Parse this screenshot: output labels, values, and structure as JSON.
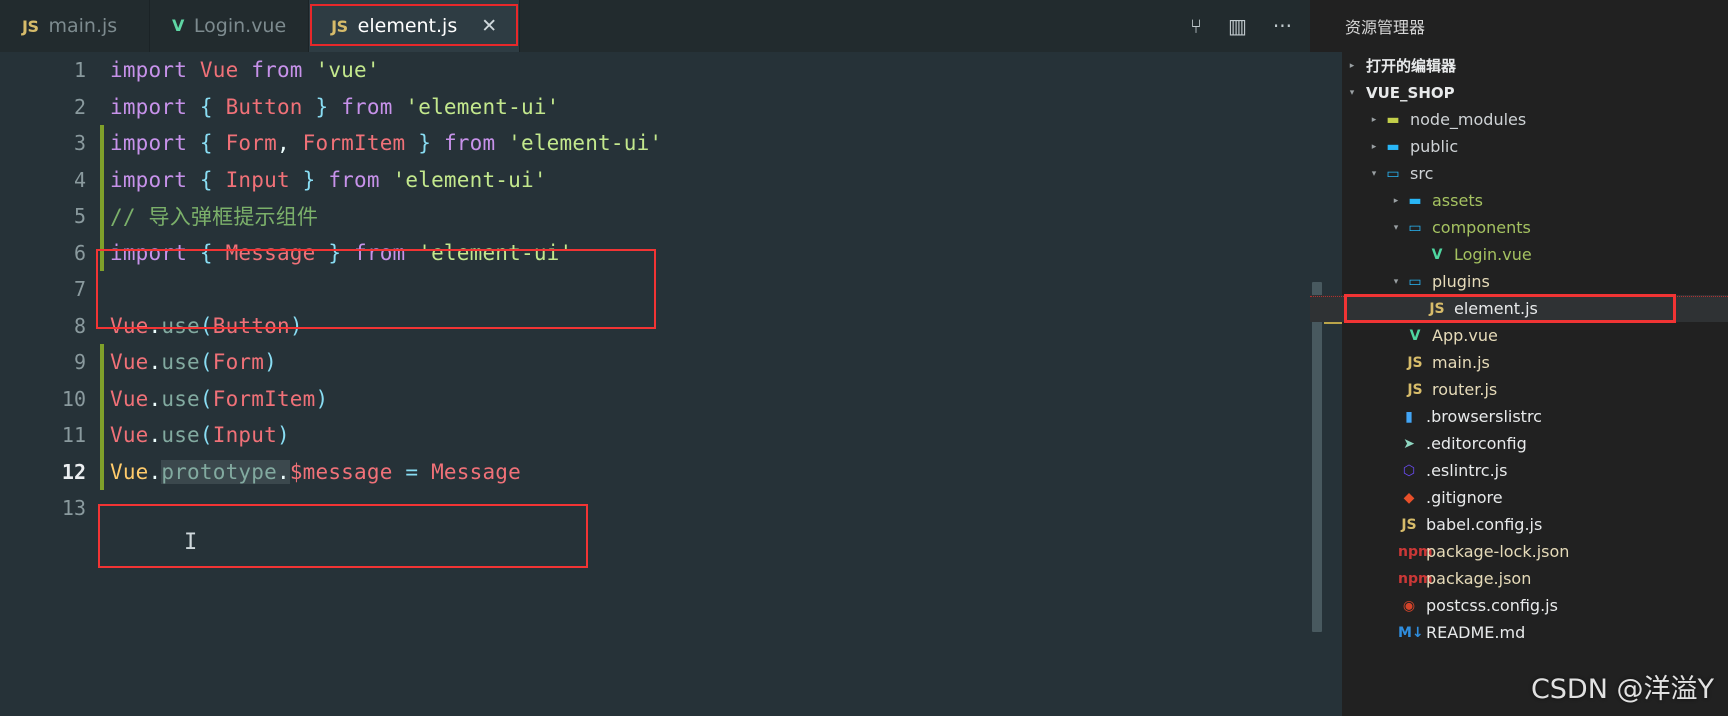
{
  "window": {
    "explorer_title": "资源管理器",
    "watermark": "CSDN @洋溢Y"
  },
  "tabbar": {
    "tabs": [
      {
        "label": "main.js",
        "icon": "js-file-icon",
        "active": false,
        "highlighted": false,
        "closable": false
      },
      {
        "label": "Login.vue",
        "icon": "vue-file-icon",
        "active": false,
        "highlighted": false,
        "closable": false
      },
      {
        "label": "element.js",
        "icon": "js-file-icon",
        "active": true,
        "highlighted": true,
        "closable": true
      }
    ],
    "close_glyph": "✕",
    "actions": [
      {
        "name": "split-compare-icon",
        "glyph": "⑂"
      },
      {
        "name": "split-editor-icon",
        "glyph": "▥"
      },
      {
        "name": "more-actions-icon",
        "glyph": "···"
      }
    ]
  },
  "editor": {
    "cursor_glyph": "I",
    "lines": [
      {
        "num": "1",
        "changed": false,
        "current": false,
        "tokens": [
          {
            "t": "import",
            "c": "t-kw"
          },
          {
            "t": " ",
            "c": "t-plain"
          },
          {
            "t": "Vue",
            "c": "t-id"
          },
          {
            "t": " ",
            "c": "t-plain"
          },
          {
            "t": "from",
            "c": "t-kw"
          },
          {
            "t": " ",
            "c": "t-plain"
          },
          {
            "t": "'vue'",
            "c": "t-str"
          }
        ]
      },
      {
        "num": "2",
        "changed": false,
        "current": false,
        "tokens": [
          {
            "t": "import",
            "c": "t-kw"
          },
          {
            "t": " ",
            "c": "t-plain"
          },
          {
            "t": "{",
            "c": "t-punc"
          },
          {
            "t": " ",
            "c": "t-plain"
          },
          {
            "t": "Button",
            "c": "t-id"
          },
          {
            "t": " ",
            "c": "t-plain"
          },
          {
            "t": "}",
            "c": "t-punc"
          },
          {
            "t": " ",
            "c": "t-plain"
          },
          {
            "t": "from",
            "c": "t-kw"
          },
          {
            "t": " ",
            "c": "t-plain"
          },
          {
            "t": "'element-ui'",
            "c": "t-str"
          }
        ]
      },
      {
        "num": "3",
        "changed": true,
        "current": false,
        "tokens": [
          {
            "t": "import",
            "c": "t-kw"
          },
          {
            "t": " ",
            "c": "t-plain"
          },
          {
            "t": "{",
            "c": "t-punc"
          },
          {
            "t": " ",
            "c": "t-plain"
          },
          {
            "t": "Form",
            "c": "t-id"
          },
          {
            "t": ",",
            "c": "t-plain"
          },
          {
            "t": " ",
            "c": "t-plain"
          },
          {
            "t": "FormItem",
            "c": "t-id"
          },
          {
            "t": " ",
            "c": "t-plain"
          },
          {
            "t": "}",
            "c": "t-punc"
          },
          {
            "t": " ",
            "c": "t-plain"
          },
          {
            "t": "from",
            "c": "t-kw"
          },
          {
            "t": " ",
            "c": "t-plain"
          },
          {
            "t": "'element-ui'",
            "c": "t-str"
          }
        ]
      },
      {
        "num": "4",
        "changed": true,
        "current": false,
        "tokens": [
          {
            "t": "import",
            "c": "t-kw"
          },
          {
            "t": " ",
            "c": "t-plain"
          },
          {
            "t": "{",
            "c": "t-punc"
          },
          {
            "t": " ",
            "c": "t-plain"
          },
          {
            "t": "Input",
            "c": "t-id"
          },
          {
            "t": " ",
            "c": "t-plain"
          },
          {
            "t": "}",
            "c": "t-punc"
          },
          {
            "t": " ",
            "c": "t-plain"
          },
          {
            "t": "from",
            "c": "t-kw"
          },
          {
            "t": " ",
            "c": "t-plain"
          },
          {
            "t": "'element-ui'",
            "c": "t-str"
          }
        ]
      },
      {
        "num": "5",
        "changed": true,
        "current": false,
        "tokens": [
          {
            "t": "// 导入弹框提示组件",
            "c": "t-com"
          }
        ]
      },
      {
        "num": "6",
        "changed": true,
        "current": false,
        "tokens": [
          {
            "t": "import",
            "c": "t-kw"
          },
          {
            "t": " ",
            "c": "t-plain"
          },
          {
            "t": "{",
            "c": "t-punc"
          },
          {
            "t": " ",
            "c": "t-plain"
          },
          {
            "t": "Message",
            "c": "t-id"
          },
          {
            "t": " ",
            "c": "t-plain"
          },
          {
            "t": "}",
            "c": "t-punc"
          },
          {
            "t": " ",
            "c": "t-plain"
          },
          {
            "t": "from",
            "c": "t-kw"
          },
          {
            "t": " ",
            "c": "t-plain"
          },
          {
            "t": "'element-ui'",
            "c": "t-str"
          }
        ]
      },
      {
        "num": "7",
        "changed": false,
        "current": false,
        "tokens": []
      },
      {
        "num": "8",
        "changed": false,
        "current": false,
        "tokens": [
          {
            "t": "Vue",
            "c": "t-id"
          },
          {
            "t": ".",
            "c": "t-plain"
          },
          {
            "t": "use",
            "c": "t-prop"
          },
          {
            "t": "(",
            "c": "t-punc"
          },
          {
            "t": "Button",
            "c": "t-id"
          },
          {
            "t": ")",
            "c": "t-punc"
          }
        ]
      },
      {
        "num": "9",
        "changed": true,
        "current": false,
        "tokens": [
          {
            "t": "Vue",
            "c": "t-id"
          },
          {
            "t": ".",
            "c": "t-plain"
          },
          {
            "t": "use",
            "c": "t-prop"
          },
          {
            "t": "(",
            "c": "t-punc"
          },
          {
            "t": "Form",
            "c": "t-id"
          },
          {
            "t": ")",
            "c": "t-punc"
          }
        ]
      },
      {
        "num": "10",
        "changed": true,
        "current": false,
        "tokens": [
          {
            "t": "Vue",
            "c": "t-id"
          },
          {
            "t": ".",
            "c": "t-plain"
          },
          {
            "t": "use",
            "c": "t-prop"
          },
          {
            "t": "(",
            "c": "t-punc"
          },
          {
            "t": "FormItem",
            "c": "t-id"
          },
          {
            "t": ")",
            "c": "t-punc"
          }
        ]
      },
      {
        "num": "11",
        "changed": true,
        "current": false,
        "tokens": [
          {
            "t": "Vue",
            "c": "t-id"
          },
          {
            "t": ".",
            "c": "t-plain"
          },
          {
            "t": "use",
            "c": "t-prop"
          },
          {
            "t": "(",
            "c": "t-punc"
          },
          {
            "t": "Input",
            "c": "t-id"
          },
          {
            "t": ")",
            "c": "t-punc"
          }
        ]
      },
      {
        "num": "12",
        "changed": true,
        "current": true,
        "tokens": [
          {
            "t": "Vue",
            "c": "t-var"
          },
          {
            "t": ".",
            "c": "t-plain"
          },
          {
            "t": "prototype",
            "c": "t-prop",
            "sel": true
          },
          {
            "t": ".",
            "c": "t-plain",
            "sel": true
          },
          {
            "t": "$message",
            "c": "t-id"
          },
          {
            "t": " ",
            "c": "t-plain"
          },
          {
            "t": "=",
            "c": "t-op"
          },
          {
            "t": " ",
            "c": "t-plain"
          },
          {
            "t": "Message",
            "c": "t-id"
          }
        ]
      },
      {
        "num": "13",
        "changed": false,
        "current": false,
        "tokens": []
      }
    ]
  },
  "sidebar": {
    "rows": [
      {
        "label": "打开的编辑器",
        "arrow": "▸",
        "icon": "",
        "iconclass": "",
        "labelclass": "lbl-white",
        "indent": 0,
        "section": true,
        "selected": false,
        "boxed": false
      },
      {
        "label": "VUE_SHOP",
        "arrow": "▾",
        "icon": "",
        "iconclass": "",
        "labelclass": "lbl-white",
        "indent": 0,
        "section": true,
        "selected": false,
        "boxed": false
      },
      {
        "label": "node_modules",
        "arrow": "▸",
        "icon": "▬",
        "iconclass": "fo-yellow",
        "labelclass": "lbl-plain",
        "indent": 22,
        "section": false,
        "selected": false,
        "boxed": false
      },
      {
        "label": "public",
        "arrow": "▸",
        "icon": "▬",
        "iconclass": "fo-blue",
        "labelclass": "lbl-plain",
        "indent": 22,
        "section": false,
        "selected": false,
        "boxed": false
      },
      {
        "label": "src",
        "arrow": "▾",
        "icon": "▭",
        "iconclass": "fo-hollow",
        "labelclass": "lbl-plain",
        "indent": 22,
        "section": false,
        "selected": false,
        "boxed": false
      },
      {
        "label": "assets",
        "arrow": "▸",
        "icon": "▬",
        "iconclass": "fo-blue",
        "labelclass": "lbl-green",
        "indent": 44,
        "section": false,
        "selected": false,
        "boxed": false
      },
      {
        "label": "components",
        "arrow": "▾",
        "icon": "▭",
        "iconclass": "fo-hollow",
        "labelclass": "lbl-green",
        "indent": 44,
        "section": false,
        "selected": false,
        "boxed": false
      },
      {
        "label": "Login.vue",
        "arrow": "",
        "icon": "V",
        "iconclass": "i-vue",
        "labelclass": "lbl-green",
        "indent": 66,
        "section": false,
        "selected": false,
        "boxed": false
      },
      {
        "label": "plugins",
        "arrow": "▾",
        "icon": "▭",
        "iconclass": "fo-hollow",
        "labelclass": "lbl-cream",
        "indent": 44,
        "section": false,
        "selected": false,
        "boxed": false
      },
      {
        "label": "element.js",
        "arrow": "",
        "icon": "JS",
        "iconclass": "i-js",
        "labelclass": "lbl-white",
        "indent": 66,
        "section": false,
        "selected": true,
        "boxed": true
      },
      {
        "label": "App.vue",
        "arrow": "",
        "icon": "V",
        "iconclass": "i-vue",
        "labelclass": "lbl-cream",
        "indent": 44,
        "section": false,
        "selected": false,
        "boxed": false
      },
      {
        "label": "main.js",
        "arrow": "",
        "icon": "JS",
        "iconclass": "i-js",
        "labelclass": "lbl-cream",
        "indent": 44,
        "section": false,
        "selected": false,
        "boxed": false
      },
      {
        "label": "router.js",
        "arrow": "",
        "icon": "JS",
        "iconclass": "i-js",
        "labelclass": "lbl-cream",
        "indent": 44,
        "section": false,
        "selected": false,
        "boxed": false
      },
      {
        "label": ".browserslistrc",
        "arrow": "",
        "icon": "▮",
        "iconclass": "i-doc",
        "labelclass": "lbl-white",
        "indent": 38,
        "section": false,
        "selected": false,
        "boxed": false
      },
      {
        "label": ".editorconfig",
        "arrow": "",
        "icon": "➤",
        "iconclass": "i-edit",
        "labelclass": "lbl-white",
        "indent": 38,
        "section": false,
        "selected": false,
        "boxed": false
      },
      {
        "label": ".eslintrc.js",
        "arrow": "",
        "icon": "⬡",
        "iconclass": "i-lint",
        "labelclass": "lbl-white",
        "indent": 38,
        "section": false,
        "selected": false,
        "boxed": false
      },
      {
        "label": ".gitignore",
        "arrow": "",
        "icon": "◆",
        "iconclass": "i-git",
        "labelclass": "lbl-white",
        "indent": 38,
        "section": false,
        "selected": false,
        "boxed": false
      },
      {
        "label": "babel.config.js",
        "arrow": "",
        "icon": "JS",
        "iconclass": "i-js",
        "labelclass": "lbl-white",
        "indent": 38,
        "section": false,
        "selected": false,
        "boxed": false
      },
      {
        "label": "package-lock.json",
        "arrow": "",
        "icon": "npm",
        "iconclass": "i-npm",
        "labelclass": "lbl-cream",
        "indent": 38,
        "section": false,
        "selected": false,
        "boxed": false
      },
      {
        "label": "package.json",
        "arrow": "",
        "icon": "npm",
        "iconclass": "i-npm",
        "labelclass": "lbl-cream",
        "indent": 38,
        "section": false,
        "selected": false,
        "boxed": false
      },
      {
        "label": "postcss.config.js",
        "arrow": "",
        "icon": "◉",
        "iconclass": "i-post",
        "labelclass": "lbl-white",
        "indent": 38,
        "section": false,
        "selected": false,
        "boxed": false
      },
      {
        "label": "README.md",
        "arrow": "",
        "icon": "M↓",
        "iconclass": "i-md",
        "labelclass": "lbl-white",
        "indent": 38,
        "section": false,
        "selected": false,
        "boxed": false
      }
    ]
  }
}
